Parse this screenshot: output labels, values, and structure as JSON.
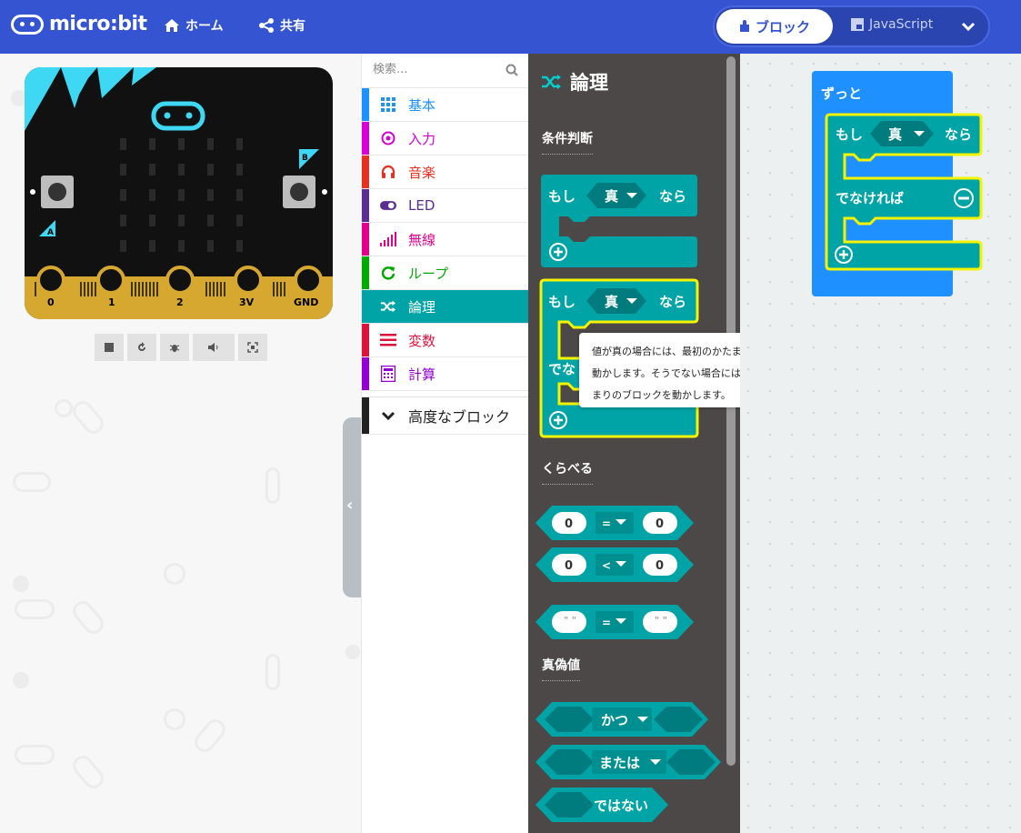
{
  "header": {
    "logo_text": "micro:bit",
    "home_label": "ホーム",
    "share_label": "共有",
    "mode_blocks_label": "ブロック",
    "mode_js_label": "JavaScript"
  },
  "simulator": {
    "pins": [
      "0",
      "1",
      "2",
      "3V",
      "GND"
    ],
    "button_a": "A",
    "button_b": "B",
    "tools": [
      "stop-icon",
      "restart-icon",
      "debug-icon",
      "mute-icon",
      "screenshot-icon"
    ]
  },
  "toolbox": {
    "search_placeholder": "検索...",
    "categories": [
      {
        "label": "基本",
        "color": "#1e90ff",
        "icon": "grid-icon"
      },
      {
        "label": "入力",
        "color": "#d400d4",
        "icon": "target-icon"
      },
      {
        "label": "音楽",
        "color": "#e63022",
        "icon": "headphones-icon"
      },
      {
        "label": "LED",
        "color": "#5c2d91",
        "icon": "toggle-icon"
      },
      {
        "label": "無線",
        "color": "#e3008c",
        "icon": "signal-icon"
      },
      {
        "label": "ループ",
        "color": "#00aa00",
        "icon": "loop-icon"
      },
      {
        "label": "論理",
        "color": "#00a4a6",
        "icon": "shuffle-icon"
      },
      {
        "label": "変数",
        "color": "#dc143c",
        "icon": "lines-icon"
      },
      {
        "label": "計算",
        "color": "#9400d3",
        "icon": "calculator-icon"
      }
    ],
    "advanced_label": "高度なブロック"
  },
  "flyout": {
    "title": "論理",
    "section_conditions": "条件判断",
    "section_compare": "くらべる",
    "section_boolean": "真偽値",
    "if_label": "もし",
    "then_label": "なら",
    "else_label": "でなければ",
    "else_short": "でな",
    "true_label": "真",
    "eq_op": "=",
    "lt_op": "<",
    "zero": "0",
    "quote": "\" \"",
    "and_label": "かつ",
    "or_label": "または",
    "not_label": "ではない"
  },
  "tooltip": {
    "text": "値が真の場合には、最初のかたまりのブロックを動かします。そうでない場合には、二番目のかたまりのブロックを動かします。"
  },
  "workspace": {
    "forever_label": "ずっと",
    "if_label": "もし",
    "true_label": "真",
    "then_label": "なら",
    "else_label": "でなければ"
  },
  "colors": {
    "header": "#3454d1",
    "logic": "#00a4a6",
    "forever": "#1e90ff",
    "highlight": "#f4f400"
  }
}
